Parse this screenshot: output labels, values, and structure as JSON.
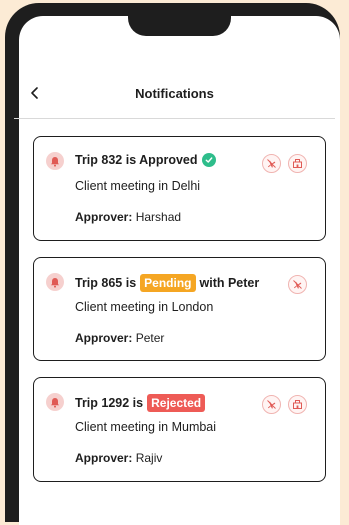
{
  "header": {
    "back_glyph": "‹",
    "title": "Notifications"
  },
  "notifications": [
    {
      "trip_prefix": "Trip 832 is Approved",
      "status": "approved",
      "description": "Client meeting in Delhi",
      "approver_label": "Approver:",
      "approver_name": "Harshad",
      "icons": [
        "flight-cancel-icon",
        "hotel-icon"
      ]
    },
    {
      "trip_prefix": "Trip 865 is",
      "status": "pending",
      "status_label": "Pending",
      "trip_suffix": "with Peter",
      "description": "Client meeting in London",
      "approver_label": "Approver:",
      "approver_name": "Peter",
      "icons": [
        "flight-cancel-icon"
      ]
    },
    {
      "trip_prefix": "Trip 1292 is",
      "status": "rejected",
      "status_label": "Rejected",
      "description": "Client meeting in Mumbai",
      "approver_label": "Approver:",
      "approver_name": "Rajiv",
      "icons": [
        "flight-cancel-icon",
        "hotel-icon"
      ]
    }
  ],
  "colors": {
    "background": "#FCEBD5",
    "phone_frame": "#1E1E1E",
    "approved": "#2EBD8B",
    "pending": "#F5A623",
    "rejected": "#EE5B56",
    "bell": "#E05A55"
  }
}
